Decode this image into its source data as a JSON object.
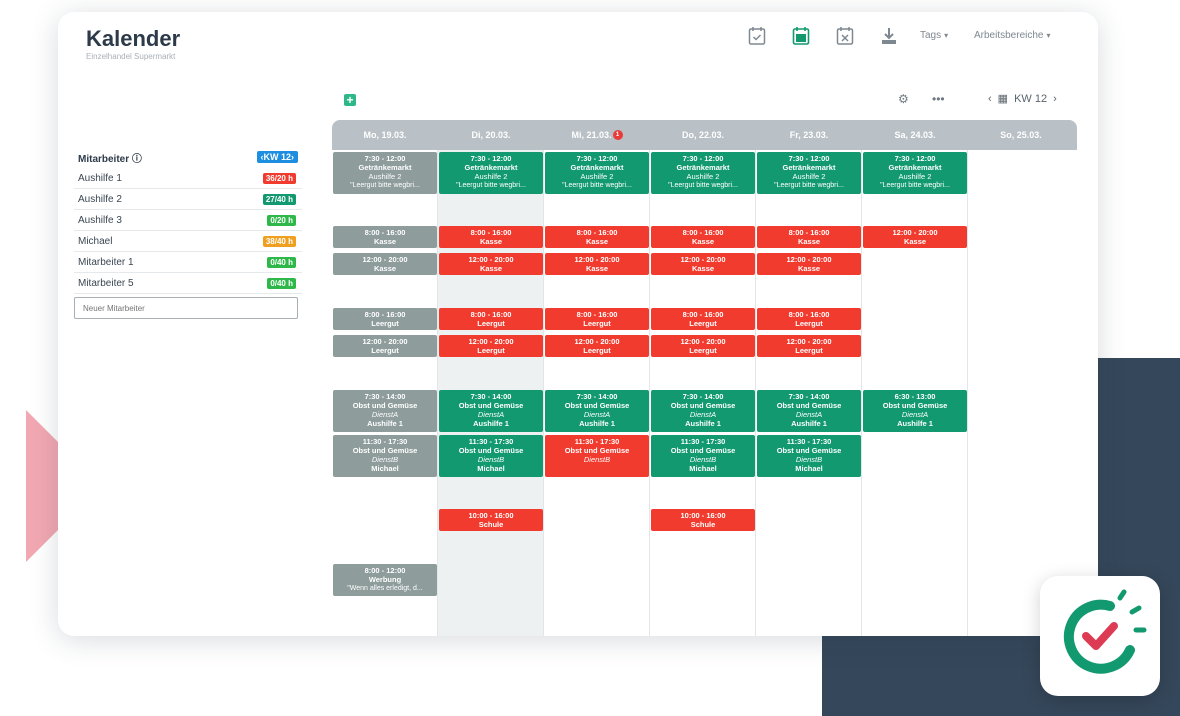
{
  "header": {
    "title": "Kalender",
    "subtitle": "Einzelhandel Supermarkt",
    "tags_label": "Tags",
    "areas_label": "Arbeitsbereiche",
    "kw_label": "KW 12"
  },
  "colors": {
    "gray_shift": "#8e9c9b",
    "green_shift": "#12996f",
    "red_shift": "#f23b2f",
    "accent_blue": "#1e8fe0",
    "navy": "#35475a"
  },
  "staff": {
    "header_label": "Mitarbeiter",
    "kw_badge": "‹KW 12›",
    "new_placeholder": "Neuer Mitarbeiter",
    "rows": [
      {
        "name": "Aushilfe 1",
        "hours": "36/20 h",
        "color": "#f23b2f"
      },
      {
        "name": "Aushilfe 2",
        "hours": "27/40 h",
        "color": "#12996f"
      },
      {
        "name": "Aushilfe 3",
        "hours": "0/20 h",
        "color": "#2eb84a"
      },
      {
        "name": "Michael",
        "hours": "38/40 h",
        "color": "#f0a020"
      },
      {
        "name": "Mitarbeiter 1",
        "hours": "0/40 h",
        "color": "#2eb84a"
      },
      {
        "name": "Mitarbeiter 5",
        "hours": "0/40 h",
        "color": "#2eb84a"
      }
    ]
  },
  "calendar": {
    "days": [
      "Mo, 19.03.",
      "Di, 20.03.",
      "Mi, 21.03.",
      "Do, 22.03.",
      "Fr, 23.03.",
      "Sa, 24.03.",
      "So, 25.03."
    ],
    "wed_badge": "1",
    "shifts": {
      "getraenke": {
        "time": "7:30 - 12:00",
        "role": "Getränkemarkt",
        "name": "Aushilfe 2"
      },
      "getraenke_note_mo": "\"Leergut bitte wegbri...",
      "getraenke_note": "\"Leergut bitte wegbri...",
      "kasse_a": {
        "time": "8:00 - 16:00",
        "role": "Kasse"
      },
      "kasse_b": {
        "time": "12:00 - 20:00",
        "role": "Kasse"
      },
      "leergut_a": {
        "time": "8:00 - 16:00",
        "role": "Leergut"
      },
      "leergut_b": {
        "time": "12:00 - 20:00",
        "role": "Leergut"
      },
      "obst_a": {
        "time": "7:30 - 14:00",
        "role": "Obst und Gemüse",
        "dienst": "DienstA",
        "name": "Aushilfe 1"
      },
      "obst_a_sa": {
        "time": "6:30 - 13:00",
        "role": "Obst und Gemüse",
        "dienst": "DienstA",
        "name": "Aushilfe 1"
      },
      "obst_b": {
        "time": "11:30 - 17:30",
        "role": "Obst und Gemüse",
        "dienst": "DienstB",
        "name": "Michael"
      },
      "schule": {
        "time": "10:00 - 16:00",
        "role": "Schule"
      },
      "werbung": {
        "time": "8:00 - 12:00",
        "role": "Werbung",
        "note": "\"Wenn alles erledigt, d..."
      }
    }
  }
}
